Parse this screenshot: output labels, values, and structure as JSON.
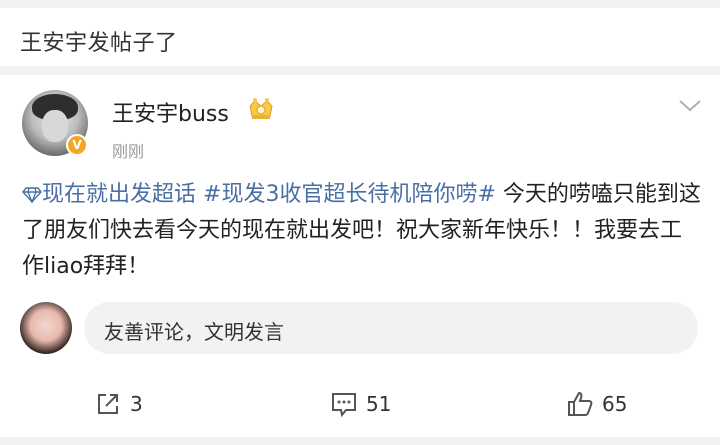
{
  "header": {
    "title": "王安宇发帖子了"
  },
  "post": {
    "username": "王安宇buss",
    "time": "刚刚",
    "verified_badge": "V",
    "topic1": "现在就出发超话",
    "topic2": "#现发3收官超长待机陪你唠#",
    "text_part1": " 今天的唠嗑只能到这了朋友们快去看今天的现在就出发吧！祝大家新年快乐！！我要去工作liao拜拜！"
  },
  "comment": {
    "placeholder": "友善评论，文明发言"
  },
  "actions": {
    "share_count": "3",
    "comment_count": "51",
    "like_count": "65"
  },
  "colors": {
    "topic": "#4a6fa5",
    "badge": "#f5a623",
    "separator": "#f2f2f2"
  },
  "icons": [
    "diamond-icon",
    "crown-badge-icon",
    "chevron-down-icon",
    "share-icon",
    "comment-icon",
    "like-icon"
  ]
}
